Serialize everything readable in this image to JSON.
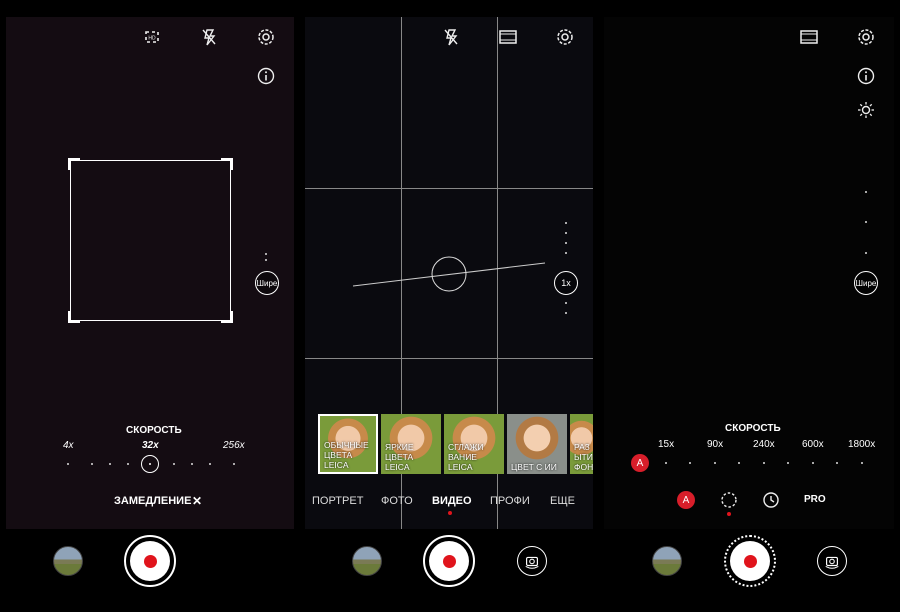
{
  "screen1": {
    "side_button": "Шире",
    "speed_title": "СКОРОСТЬ",
    "speed_labels": [
      "4x",
      "32x",
      "256x"
    ],
    "slowmo_label": "ЗАМЕДЛЕНИЕ",
    "close_glyph": "✕"
  },
  "screen2": {
    "zoom_label": "1x",
    "filters": [
      {
        "label": "ОБЫЧНЫЕ ЦВЕТА LEICA",
        "line1": "ОБЫЧНЫЕ",
        "line2": "ЦВЕТА",
        "line3": "LEICA"
      },
      {
        "label": "ЯРКИЕ ЦВЕТА LEICA",
        "line1": "ЯРКИЕ",
        "line2": "ЦВЕТА",
        "line3": "LEICA"
      },
      {
        "label": "СГЛАЖИВАНИЕ LEICA",
        "line1": "СГЛАЖИ",
        "line2": "ВАНИЕ",
        "line3": "LEICA"
      },
      {
        "label": "ЦВЕТ С ИИ",
        "line1": "",
        "line2": "",
        "line3": "ЦВЕТ С ИИ"
      },
      {
        "label": "РАЗМЫТИЕ ФОНА",
        "line1": "РАЗ",
        "line2": "ЫТИ",
        "line3": "ФОН"
      }
    ],
    "modes": [
      "ПОРТРЕТ",
      "ФОТО",
      "ВИДЕО",
      "ПРОФИ",
      "ЕЩЕ"
    ],
    "active_mode": "ВИДЕО"
  },
  "screen3": {
    "side_button": "Шире",
    "speed_title": "СКОРОСТЬ",
    "speed_labels": [
      "15x",
      "90x",
      "240x",
      "600x",
      "1800x"
    ],
    "auto_badge": "A",
    "pro_label": "PRO"
  },
  "colors": {
    "record": "#e0141c",
    "accent_red": "#d81e2a"
  },
  "icons": [
    "aspect-icon",
    "flash-off-icon",
    "settings-icon",
    "info-icon",
    "film-icon",
    "brightness-icon",
    "gallery-thumbnail",
    "camera-flip-icon",
    "timer-icon",
    "interval-icon"
  ]
}
